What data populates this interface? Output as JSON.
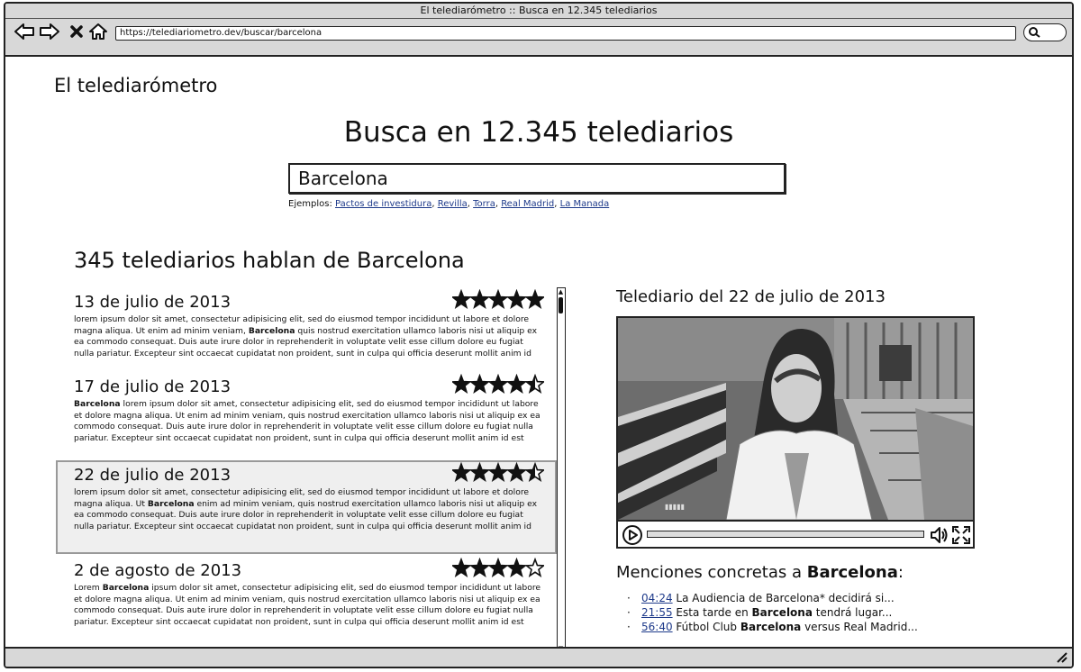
{
  "window": {
    "title": "El telediarómetro :: Busca en 12.345 telediarios",
    "url": "https://telediariometro.dev/buscar/barcelona"
  },
  "header": {
    "brand": "El telediarómetro"
  },
  "hero": {
    "title": "Busca en 12.345 telediarios"
  },
  "search": {
    "query": "Barcelona",
    "examples_label": "Ejemplos:",
    "examples": [
      "Pactos de investidura",
      "Revilla",
      "Torra",
      "Real Madrid",
      "La Manada"
    ]
  },
  "results": {
    "heading": "345 telediarios hablan de Barcelona",
    "items": [
      {
        "date": "13 de julio de 2013",
        "rating": 5,
        "text_before": "lorem ipsum dolor sit amet, consectetur adipisicing elit, sed do eiusmod tempor incididunt ut labore et dolore magna aliqua. Ut enim ad minim veniam, ",
        "highlight": "Barcelona",
        "text_after": " quis nostrud exercitation ullamco laboris nisi ut aliquip ex ea commodo consequat. Duis aute irure dolor in reprehenderit in voluptate velit esse cillum dolore eu fugiat nulla pariatur. Excepteur sint occaecat cupidatat non proident, sunt in culpa qui officia deserunt mollit anim id est laborum."
      },
      {
        "date": "17 de julio de 2013",
        "rating": 4.5,
        "text_before": "",
        "highlight": "Barcelona",
        "text_after": " lorem ipsum dolor sit amet, consectetur adipisicing elit, sed do eiusmod tempor incididunt ut labore et dolore magna aliqua. Ut enim ad minim veniam, quis nostrud exercitation ullamco laboris nisi ut aliquip ex ea commodo consequat. Duis aute irure dolor in reprehenderit in voluptate velit esse cillum dolore eu fugiat nulla pariatur. Excepteur sint occaecat cupidatat non proident, sunt in culpa qui officia deserunt mollit anim id est laborum."
      },
      {
        "date": "22 de julio de 2013",
        "rating": 4.5,
        "selected": true,
        "text_before": "lorem ipsum dolor sit amet, consectetur adipisicing elit, sed do eiusmod tempor incididunt ut labore et dolore magna aliqua. Ut ",
        "highlight": "Barcelona",
        "text_after": " enim ad minim veniam, quis nostrud exercitation ullamco laboris nisi ut aliquip ex ea commodo consequat. Duis aute irure dolor in reprehenderit in voluptate velit esse cillum dolore eu fugiat nulla pariatur. Excepteur sint occaecat cupidatat non proident, sunt in culpa qui officia deserunt mollit anim id est laborum."
      },
      {
        "date": "2 de agosto de 2013",
        "rating": 4,
        "text_before": "Lorem ",
        "highlight": "Barcelona",
        "text_after": " ipsum dolor sit amet, consectetur adipisicing elit, sed do eiusmod tempor incididunt ut labore et dolore magna aliqua. Ut enim ad minim veniam, quis nostrud exercitation ullamco laboris nisi ut aliquip ex ea commodo consequat. Duis aute irure dolor in reprehenderit in voluptate velit esse cillum dolore eu fugiat nulla pariatur. Excepteur sint occaecat cupidatat non proident, sunt in culpa qui officia deserunt mollit anim id est laborum."
      }
    ]
  },
  "player": {
    "title": "Telediario del 22 de julio de 2013"
  },
  "mentions": {
    "title_prefix": "Menciones concretas a ",
    "title_keyword": "Barcelona",
    "title_suffix": ":",
    "items": [
      {
        "time": "04:24",
        "before": "La Audiencia de Barcelona* decidirá si...",
        "highlight": "",
        "after": ""
      },
      {
        "time": "21:55",
        "before": "Esta tarde en ",
        "highlight": "Barcelona",
        "after": " tendrá lugar..."
      },
      {
        "time": "56:40",
        "before": "Fútbol Club ",
        "highlight": "Barcelona",
        "after": " versus Real Madrid..."
      }
    ]
  },
  "icons": {
    "back": "arrow-left-icon",
    "forward": "arrow-right-icon",
    "stop": "close-icon",
    "home": "home-icon",
    "search": "search-icon",
    "play": "play-icon",
    "volume": "volume-icon",
    "fullscreen": "fullscreen-icon",
    "resize": "resize-grip-icon"
  }
}
